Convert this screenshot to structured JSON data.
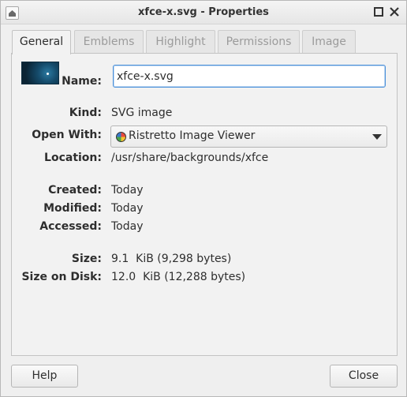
{
  "window": {
    "title": "xfce-x.svg - Properties",
    "icons": {
      "menu": "window-menu-icon",
      "maximize": "maximize-icon",
      "close": "close-icon"
    }
  },
  "tabs": [
    {
      "label": "General",
      "active": true
    },
    {
      "label": "Emblems",
      "active": false
    },
    {
      "label": "Highlight",
      "active": false
    },
    {
      "label": "Permissions",
      "active": false
    },
    {
      "label": "Image",
      "active": false
    }
  ],
  "general": {
    "name_label": "Name:",
    "name_value": "xfce-x.svg",
    "kind_label": "Kind:",
    "kind_value": "SVG image",
    "open_with_label": "Open With:",
    "open_with_value": "Ristretto Image Viewer",
    "location_label": "Location:",
    "location_value": "/usr/share/backgrounds/xfce",
    "created_label": "Created:",
    "created_value": "Today",
    "modified_label": "Modified:",
    "modified_value": "Today",
    "accessed_label": "Accessed:",
    "accessed_value": "Today",
    "size_label": "Size:",
    "size_value": "9.1  KiB (9,298 bytes)",
    "size_on_disk_label": "Size on Disk:",
    "size_on_disk_value": "12.0  KiB (12,288 bytes)"
  },
  "footer": {
    "help_label": "Help",
    "close_label": "Close"
  },
  "colors": {
    "focus": "#4a90d9"
  }
}
